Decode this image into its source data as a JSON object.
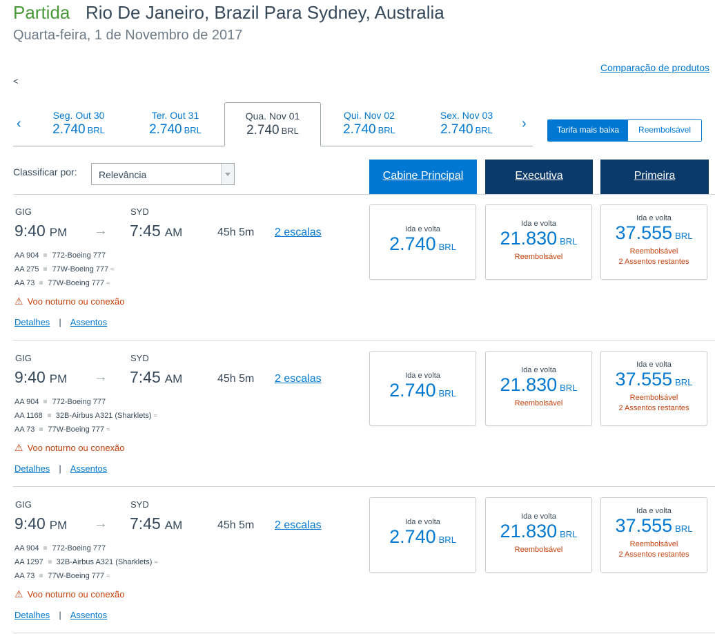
{
  "header": {
    "label": "Partida",
    "route": "Rio De Janeiro, Brazil Para Sydney, Australia",
    "date": "Quarta-feira, 1 de Novembro de 2017"
  },
  "compare_link": "Comparação de produtos",
  "back_char": "<",
  "date_nav": {
    "prev": "‹",
    "next": "›",
    "tabs": [
      {
        "label": "Seg. Out 30",
        "price": "2.740",
        "currency": "BRL",
        "active": false
      },
      {
        "label": "Ter. Out 31",
        "price": "2.740",
        "currency": "BRL",
        "active": false
      },
      {
        "label": "Qua. Nov 01",
        "price": "2.740",
        "currency": "BRL",
        "active": true
      },
      {
        "label": "Qui. Nov 02",
        "price": "2.740",
        "currency": "BRL",
        "active": false
      },
      {
        "label": "Sex. Nov 03",
        "price": "2.740",
        "currency": "BRL",
        "active": false
      }
    ]
  },
  "fare_toggle": {
    "lowest": "Tarifa mais baixa",
    "refundable": "Reembolsável"
  },
  "sort": {
    "label": "Classificar por:",
    "value": "Relevância"
  },
  "cabins": {
    "main": "Cabine Principal",
    "business": "Executiva",
    "first": "Primeira"
  },
  "flights": [
    {
      "origin": "GIG",
      "destination": "SYD",
      "depart_time": "9:40",
      "depart_ampm": "PM",
      "arrive_time": "7:45",
      "arrive_ampm": "AM",
      "duration": "45h  5m",
      "stops": "2 escalas",
      "segments": [
        {
          "flight": "AA 904",
          "aircraft": "772-Boeing 777",
          "wifi": false
        },
        {
          "flight": "AA 275",
          "aircraft": "77W-Boeing 777",
          "wifi": true
        },
        {
          "flight": "AA 73",
          "aircraft": "77W-Boeing 777",
          "wifi": true
        }
      ],
      "warning": "Voo noturno ou conexão",
      "details": "Detalhes",
      "seats": "Assentos",
      "link_sep": "|",
      "fares": {
        "main": {
          "type": "Ida e volta",
          "price": "2.740",
          "currency": "BRL",
          "notes": []
        },
        "business": {
          "type": "Ida e volta",
          "price": "21.830",
          "currency": "BRL",
          "notes": [
            "Reembolsável"
          ]
        },
        "first": {
          "type": "Ida e volta",
          "price": "37.555",
          "currency": "BRL",
          "notes": [
            "Reembolsável",
            "2 Assentos restantes"
          ]
        }
      }
    },
    {
      "origin": "GIG",
      "destination": "SYD",
      "depart_time": "9:40",
      "depart_ampm": "PM",
      "arrive_time": "7:45",
      "arrive_ampm": "AM",
      "duration": "45h  5m",
      "stops": "2 escalas",
      "segments": [
        {
          "flight": "AA 904",
          "aircraft": "772-Boeing 777",
          "wifi": false
        },
        {
          "flight": "AA 1168",
          "aircraft": "32B-Airbus A321 (Sharklets)",
          "wifi": true
        },
        {
          "flight": "AA 73",
          "aircraft": "77W-Boeing 777",
          "wifi": true
        }
      ],
      "warning": "Voo noturno ou conexão",
      "details": "Detalhes",
      "seats": "Assentos",
      "link_sep": "|",
      "fares": {
        "main": {
          "type": "Ida e volta",
          "price": "2.740",
          "currency": "BRL",
          "notes": []
        },
        "business": {
          "type": "Ida e volta",
          "price": "21.830",
          "currency": "BRL",
          "notes": [
            "Reembolsável"
          ]
        },
        "first": {
          "type": "Ida e volta",
          "price": "37.555",
          "currency": "BRL",
          "notes": [
            "Reembolsável",
            "2 Assentos restantes"
          ]
        }
      }
    },
    {
      "origin": "GIG",
      "destination": "SYD",
      "depart_time": "9:40",
      "depart_ampm": "PM",
      "arrive_time": "7:45",
      "arrive_ampm": "AM",
      "duration": "45h  5m",
      "stops": "2 escalas",
      "segments": [
        {
          "flight": "AA 904",
          "aircraft": "772-Boeing 777",
          "wifi": false
        },
        {
          "flight": "AA 1297",
          "aircraft": "32B-Airbus A321 (Sharklets)",
          "wifi": true
        },
        {
          "flight": "AA 73",
          "aircraft": "77W-Boeing 777",
          "wifi": true
        }
      ],
      "warning": "Voo noturno ou conexão",
      "details": "Detalhes",
      "seats": "Assentos",
      "link_sep": "|",
      "fares": {
        "main": {
          "type": "Ida e volta",
          "price": "2.740",
          "currency": "BRL",
          "notes": []
        },
        "business": {
          "type": "Ida e volta",
          "price": "21.830",
          "currency": "BRL",
          "notes": [
            "Reembolsável"
          ]
        },
        "first": {
          "type": "Ida e volta",
          "price": "37.555",
          "currency": "BRL",
          "notes": [
            "Reembolsável",
            "2 Assentos restantes"
          ]
        }
      }
    }
  ],
  "icons": {
    "arrow": "right-arrow-icon",
    "warning": "warning-icon",
    "wifi": "wifi-icon",
    "segment": "square-bullet-icon"
  },
  "colors": {
    "accent": "#0078d2",
    "dark_cabin": "#0a3a6a",
    "warning": "#c2410c",
    "green": "#4a9a3a"
  }
}
